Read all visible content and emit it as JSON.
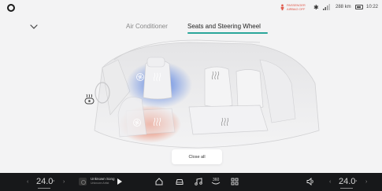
{
  "status_bar": {
    "airbag_line1": "PASSENGER",
    "airbag_line2": "AIRBAG OFF",
    "range": "288 km",
    "clock": "10:22"
  },
  "tabs": {
    "air": "Air Conditioner",
    "seats": "Seats and Steering Wheel"
  },
  "close_all_label": "Close all",
  "dock": {
    "left_temp": "24.0",
    "right_temp": "24.0",
    "temp_unit": "°",
    "song_title": "Unknown Song",
    "song_artist": "Unknown Artist",
    "fan_label": "360"
  },
  "colors": {
    "accent": "#2aa69a",
    "cool": "#4a7fe0",
    "heat": "#e05a3c",
    "dock_bg": "#17181a"
  }
}
